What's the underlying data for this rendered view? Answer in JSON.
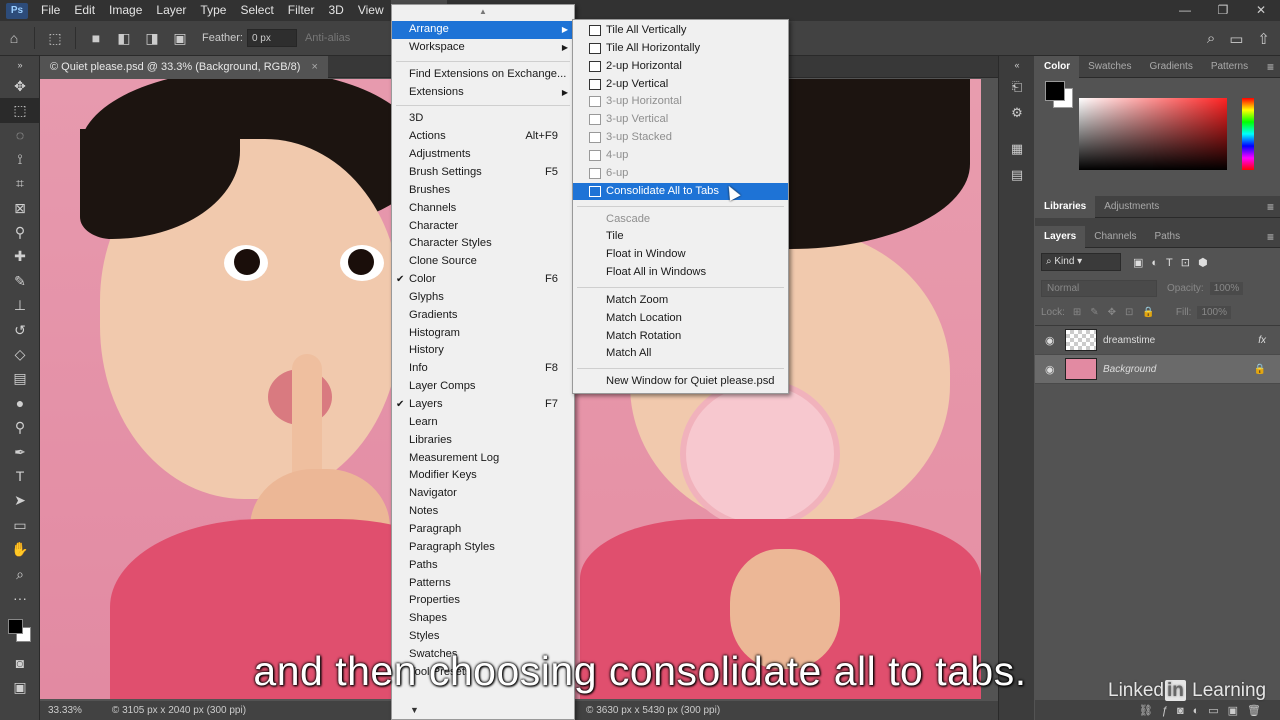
{
  "menubar": {
    "logo": "Ps",
    "items": [
      "File",
      "Edit",
      "Image",
      "Layer",
      "Type",
      "Select",
      "Filter",
      "3D",
      "View",
      "Window"
    ],
    "active": "Window",
    "window_controls": [
      "—",
      "❐",
      "✕"
    ]
  },
  "options": {
    "feather_label": "Feather:",
    "feather_value": "0 px",
    "antialias_label": "Anti-alias"
  },
  "document": {
    "tab_title": "© Quiet please.psd @ 33.3% (Background, RGB/8)",
    "tab_close": "×",
    "zoom": "33.33%",
    "info_left": "© 3105 px x 2040 px (300 ppi)",
    "info_right": "© 3630 px x 5430 px (300 ppi)"
  },
  "panels": {
    "color_tabs": [
      "Color",
      "Swatches",
      "Gradients",
      "Patterns"
    ],
    "lib_tabs": [
      "Libraries",
      "Adjustments"
    ],
    "layer_tabs": [
      "Layers",
      "Channels",
      "Paths"
    ],
    "kind": "Kind",
    "blend": "Normal",
    "opacity_label": "Opacity:",
    "opacity": "100%",
    "lock_label": "Lock:",
    "fill_label": "Fill:",
    "fill": "100%",
    "layers": [
      {
        "name": "dreamstime",
        "fx": "fx"
      },
      {
        "name": "Background"
      }
    ]
  },
  "window_menu": {
    "items": [
      {
        "label": "Arrange",
        "sub": true,
        "hi": true
      },
      {
        "label": "Workspace",
        "sub": true
      },
      {
        "sep": true
      },
      {
        "label": "Find Extensions on Exchange..."
      },
      {
        "label": "Extensions",
        "sub": true
      },
      {
        "sep": true
      },
      {
        "label": "3D"
      },
      {
        "label": "Actions",
        "sc": "Alt+F9"
      },
      {
        "label": "Adjustments"
      },
      {
        "label": "Brush Settings",
        "sc": "F5"
      },
      {
        "label": "Brushes"
      },
      {
        "label": "Channels"
      },
      {
        "label": "Character"
      },
      {
        "label": "Character Styles"
      },
      {
        "label": "Clone Source"
      },
      {
        "label": "Color",
        "sc": "F6",
        "check": true
      },
      {
        "label": "Glyphs"
      },
      {
        "label": "Gradients"
      },
      {
        "label": "Histogram"
      },
      {
        "label": "History"
      },
      {
        "label": "Info",
        "sc": "F8"
      },
      {
        "label": "Layer Comps"
      },
      {
        "label": "Layers",
        "sc": "F7",
        "check": true
      },
      {
        "label": "Learn"
      },
      {
        "label": "Libraries"
      },
      {
        "label": "Measurement Log"
      },
      {
        "label": "Modifier Keys"
      },
      {
        "label": "Navigator"
      },
      {
        "label": "Notes"
      },
      {
        "label": "Paragraph"
      },
      {
        "label": "Paragraph Styles"
      },
      {
        "label": "Paths"
      },
      {
        "label": "Patterns"
      },
      {
        "label": "Properties"
      },
      {
        "label": "Shapes"
      },
      {
        "label": "Styles"
      },
      {
        "label": "Swatches"
      },
      {
        "label": "Tool Presets"
      }
    ]
  },
  "arrange_menu": {
    "items": [
      {
        "label": "Tile All Vertically"
      },
      {
        "label": "Tile All Horizontally"
      },
      {
        "label": "2-up Horizontal"
      },
      {
        "label": "2-up Vertical"
      },
      {
        "label": "3-up Horizontal",
        "dis": true
      },
      {
        "label": "3-up Vertical",
        "dis": true
      },
      {
        "label": "3-up Stacked",
        "dis": true
      },
      {
        "label": "4-up",
        "dis": true
      },
      {
        "label": "6-up",
        "dis": true
      },
      {
        "label": "Consolidate All to Tabs",
        "hi": true
      },
      {
        "sep": true
      },
      {
        "label": "Cascade",
        "dis": true,
        "noicon": true
      },
      {
        "label": "Tile",
        "noicon": true
      },
      {
        "label": "Float in Window",
        "noicon": true
      },
      {
        "label": "Float All in Windows",
        "noicon": true
      },
      {
        "sep": true
      },
      {
        "label": "Match Zoom",
        "noicon": true
      },
      {
        "label": "Match Location",
        "noicon": true
      },
      {
        "label": "Match Rotation",
        "noicon": true
      },
      {
        "label": "Match All",
        "noicon": true
      },
      {
        "sep": true
      },
      {
        "label": "New Window for Quiet please.psd",
        "noicon": true
      }
    ]
  },
  "subtitle": "and then choosing consolidate all to tabs.",
  "watermark": {
    "a": "Linked",
    "b": "in",
    "c": " Learning"
  }
}
